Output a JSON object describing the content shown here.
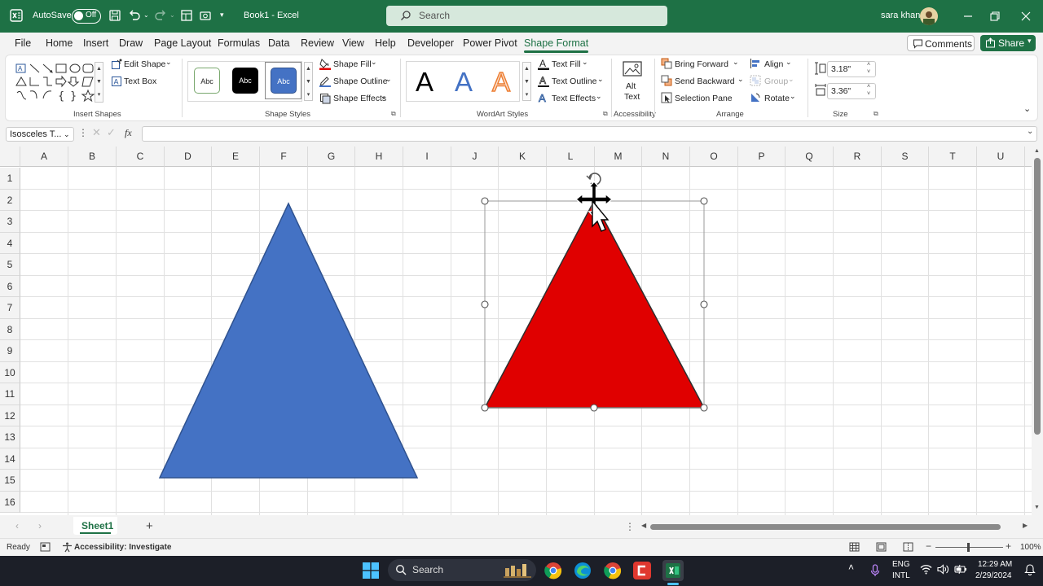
{
  "titlebar": {
    "autosave_label": "AutoSave",
    "autosave_state": "Off",
    "doc_title": "Book1  -  Excel",
    "search_placeholder": "Search",
    "user_name": "sara khan"
  },
  "menu": {
    "tabs": [
      "File",
      "Home",
      "Insert",
      "Draw",
      "Page Layout",
      "Formulas",
      "Data",
      "Review",
      "View",
      "Help",
      "Developer",
      "Power Pivot",
      "Shape Format"
    ],
    "active_tab": "Shape Format",
    "comments_label": "Comments",
    "share_label": "Share"
  },
  "ribbon": {
    "insert_shapes": {
      "edit_shape": "Edit Shape",
      "text_box": "Text Box",
      "label": "Insert Shapes"
    },
    "shape_styles": {
      "preset_labels": [
        "Abc",
        "Abc",
        "Abc"
      ],
      "fill": "Shape Fill",
      "outline": "Shape Outline",
      "effects": "Shape Effects",
      "label": "Shape Styles"
    },
    "wordart_styles": {
      "letters": [
        "A",
        "A",
        "A"
      ],
      "text_fill": "Text Fill",
      "text_outline": "Text Outline",
      "text_effects": "Text Effects",
      "label": "WordArt Styles"
    },
    "accessibility": {
      "alt_text_line1": "Alt",
      "alt_text_line2": "Text",
      "label": "Accessibility"
    },
    "arrange": {
      "bring_forward": "Bring Forward",
      "send_backward": "Send Backward",
      "selection_pane": "Selection Pane",
      "align": "Align",
      "group": "Group",
      "rotate": "Rotate",
      "label": "Arrange"
    },
    "size": {
      "height": "3.18\"",
      "width": "3.36\"",
      "label": "Size"
    }
  },
  "formula_bar": {
    "name_box": "Isosceles T...",
    "fx": "fx"
  },
  "grid": {
    "columns": [
      "A",
      "B",
      "C",
      "D",
      "E",
      "F",
      "G",
      "H",
      "I",
      "J",
      "K",
      "L",
      "M",
      "N",
      "O",
      "P",
      "Q",
      "R",
      "S",
      "T",
      "U"
    ],
    "rows": [
      "1",
      "2",
      "3",
      "4",
      "5",
      "6",
      "7",
      "8",
      "9",
      "10",
      "11",
      "12",
      "13",
      "14",
      "15",
      "16"
    ]
  },
  "shapes": {
    "blue_triangle_fill": "#4472c4",
    "red_triangle_fill": "#e00000"
  },
  "sheets": {
    "active": "Sheet1"
  },
  "status": {
    "ready": "Ready",
    "accessibility": "Accessibility: Investigate",
    "zoom": "100%"
  },
  "taskbar": {
    "search_label": "Search",
    "lang_line1": "ENG",
    "lang_line2": "INTL",
    "time": "12:29 AM",
    "date": "2/29/2024"
  }
}
